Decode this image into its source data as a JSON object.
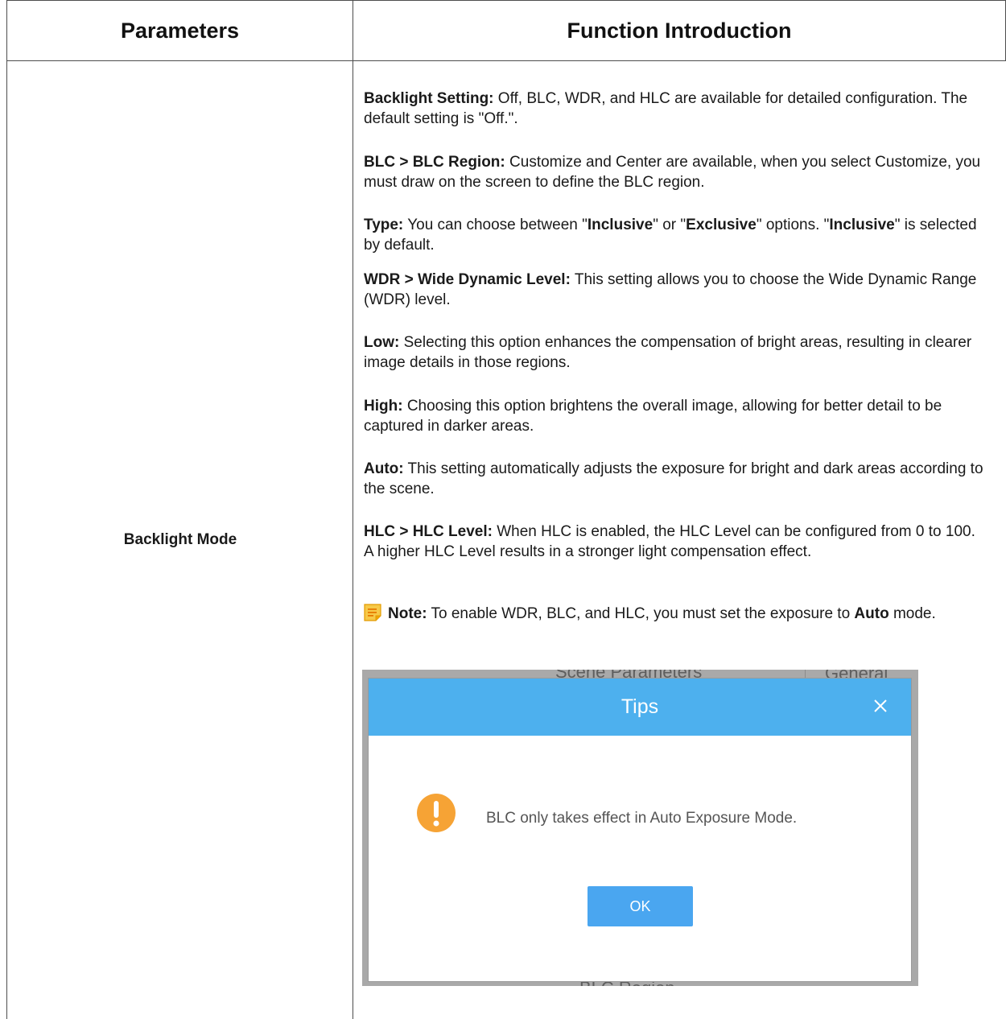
{
  "table": {
    "headers": [
      "Parameters",
      "Function Introduction"
    ],
    "parameter": "Backlight Mode",
    "paragraphs": [
      {
        "label": "Backlight Setting:",
        "text": " Off, BLC, WDR, and HLC are available for detailed configuration. The default setting is \"Off.\"."
      },
      {
        "label": "BLC > BLC Region:",
        "text": " Customize and Center are available, when you select Customize, you must draw on the screen to define the BLC region."
      },
      {
        "label": "WDR > Wide Dynamic Level:",
        "text": "  This setting allows you to choose the Wide Dynamic Range (WDR) level."
      },
      {
        "label": "Low:",
        "text": " Selecting this option enhances the compensation of bright areas, resulting in clearer image details in those regions."
      },
      {
        "label": "High:",
        "text": " Choosing this option brightens the overall image, allowing for better detail to be captured in darker areas."
      },
      {
        "label": "Auto:",
        "text": " This setting automatically adjusts the exposure for bright and dark areas according to the scene."
      },
      {
        "label": "HLC > HLC Level:",
        "text": " When HLC is enabled, the HLC Level can be configured from 0 to 100. A higher HLC Level results in a stronger light compensation effect."
      }
    ],
    "type_para": {
      "label": "Type:",
      "t1": " You can choose between \"",
      "b1": "Inclusive",
      "t2": "\" or \"",
      "b2": "Exclusive",
      "t3": "\" options. \"",
      "b3": "Inclusive",
      "t4": "\" is selected by default."
    },
    "note": {
      "icon": "note-icon",
      "label": "Note:",
      "text1": "  To enable WDR, BLC, and HLC, you must set the exposure to ",
      "bold": "Auto",
      "text2": " mode."
    }
  },
  "screenshot": {
    "background_top_left": "Scene Parameters",
    "background_top_right": "General",
    "background_bottom_left": "BLC Region",
    "dialog": {
      "title": "Tips",
      "message": "BLC only takes effect in Auto Exposure Mode.",
      "ok_label": "OK",
      "header_color": "#4db0ee",
      "button_color": "#4aa6f0",
      "warning_color": "#f6a335"
    }
  }
}
